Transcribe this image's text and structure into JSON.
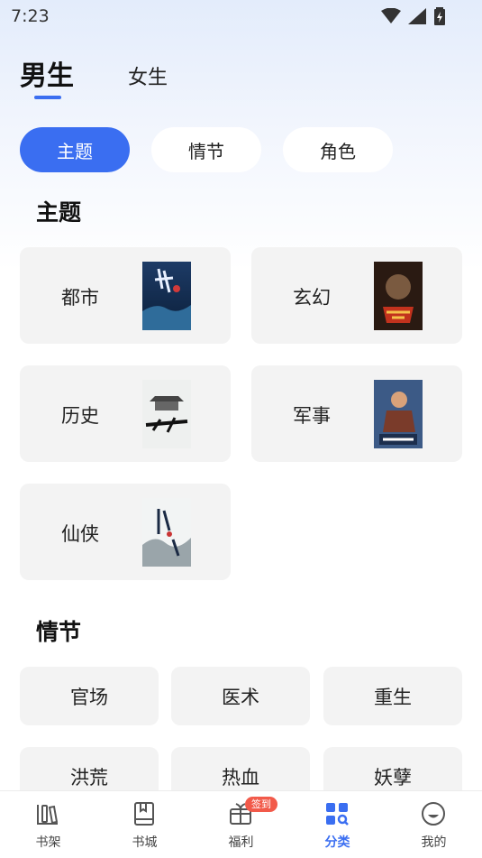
{
  "status": {
    "time": "7:23"
  },
  "gender_tabs": {
    "active": "男生",
    "other": "女生"
  },
  "chips": [
    "主题",
    "情节",
    "角色"
  ],
  "sections": {
    "theme_title": "主题",
    "plot_title": "情节"
  },
  "theme_items": [
    {
      "label": "都市",
      "cover": "book-cover-dushi"
    },
    {
      "label": "玄幻",
      "cover": "book-cover-xuanhuan"
    },
    {
      "label": "历史",
      "cover": "book-cover-lishi"
    },
    {
      "label": "军事",
      "cover": "book-cover-junshi"
    },
    {
      "label": "仙侠",
      "cover": "book-cover-xianxia"
    }
  ],
  "plot_items": [
    "官场",
    "医术",
    "重生",
    "洪荒",
    "热血",
    "妖孽"
  ],
  "bottom_nav": [
    {
      "label": "书架",
      "icon": "bookshelf-icon"
    },
    {
      "label": "书城",
      "icon": "book-icon"
    },
    {
      "label": "福利",
      "icon": "gift-icon",
      "badge": "签到"
    },
    {
      "label": "分类",
      "icon": "category-icon",
      "active": true
    },
    {
      "label": "我的",
      "icon": "profile-icon"
    }
  ],
  "colors": {
    "accent": "#3a6ef1",
    "badge": "#f25a4a",
    "card": "#f3f3f3"
  }
}
